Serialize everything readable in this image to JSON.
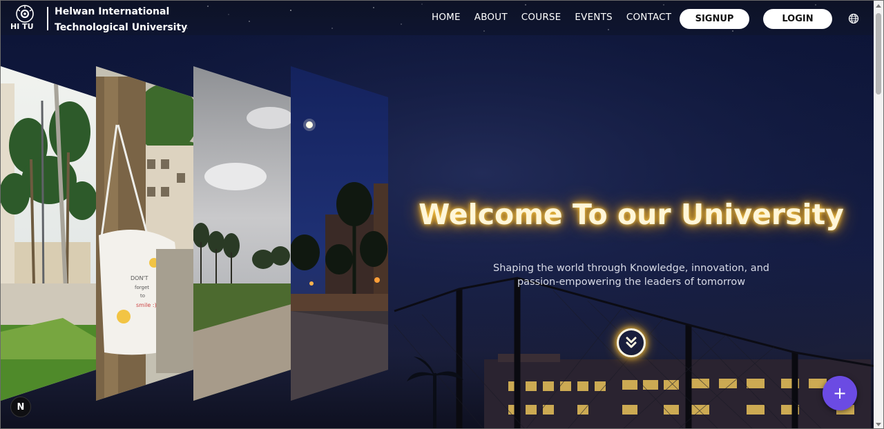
{
  "brand": {
    "logo_text": "HI TU",
    "name_line1": "Helwan International",
    "name_line2": "Technological University"
  },
  "nav": {
    "items": [
      {
        "label": "HOME"
      },
      {
        "label": "ABOUT"
      },
      {
        "label": "COURSE"
      },
      {
        "label": "EVENTS"
      },
      {
        "label": "CONTACT"
      }
    ],
    "signup_label": "SIGNUP",
    "login_label": "LOGIN",
    "language_icon": "globe-icon"
  },
  "hero": {
    "title": "Welcome To our University",
    "subtitle_line1": "Shaping the world through Knowledge, innovation, and",
    "subtitle_line2": "passion-empowering the leaders of tomorrow",
    "scroll_icon": "double-chevron-down-icon",
    "panel_images": [
      "campus-palm-trees",
      "tote-bag-on-tree",
      "cloudy-sky-campus",
      "night-campus-moon"
    ]
  },
  "fab": {
    "label": "+",
    "icon": "plus-icon"
  },
  "dev_badge": {
    "label": "N"
  },
  "colors": {
    "nav_bg": "#0d1226",
    "hero_bg": "#0b1230",
    "title_glow": "#f0a81e",
    "fab": "#6b4be3",
    "button_bg": "#ffffff"
  }
}
